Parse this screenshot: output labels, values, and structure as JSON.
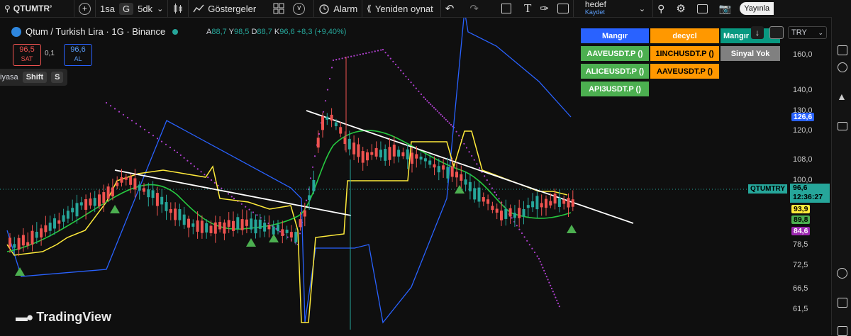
{
  "topbar": {
    "symbol": "QTUMTRʼ",
    "add": "+",
    "interval_1": "1sa",
    "interval_2": "G",
    "interval_3": "5dk",
    "chevron": "⌄",
    "indicators": "Göstergeler",
    "alert": "Alarm",
    "replay": "Yeniden oynat",
    "layout_name": "hedef",
    "layout_status": "Kaydet",
    "publish": "Yayınla",
    "v_label": "v",
    "text_tool": "T"
  },
  "header": {
    "title": "Qtum / Turkish Lira · 1G · Binance",
    "ohlc": [
      {
        "k": "A",
        "v": "88,7"
      },
      {
        "k": "Y",
        "v": "98,5"
      },
      {
        "k": "D",
        "v": "88,7"
      },
      {
        "k": "K",
        "v": "96,6"
      }
    ],
    "change": "+8,3 (+9,40%)",
    "sell_price": "96,5",
    "sell_label": "SAT",
    "spread": "0,1",
    "buy_price": "96,6",
    "buy_label": "AL"
  },
  "order_bar": {
    "text": "iyasa",
    "key1": "Shift",
    "key2": "S"
  },
  "scale_controls": {
    "currency": "TRY"
  },
  "table": {
    "headers": [
      {
        "text": "Mangır",
        "bg": "#2962ff",
        "fg": "#ffffff"
      },
      {
        "text": "decycl",
        "bg": "#ff9800",
        "fg": "#ffffff"
      },
      {
        "text": "Mangır 3b",
        "bg": "#089981",
        "fg": "#ffffff"
      }
    ],
    "rows": [
      [
        {
          "text": "AAVEUSDT.P ()",
          "bg": "#4caf50",
          "fg": "#ffffff"
        },
        {
          "text": "1INCHUSDT.P ()",
          "bg": "#ff9800",
          "fg": "#000000"
        },
        {
          "text": "Sinyal Yok",
          "bg": "#808080",
          "fg": "#ffffff"
        }
      ],
      [
        {
          "text": "ALICEUSDT.P ()",
          "bg": "#4caf50",
          "fg": "#ffffff"
        },
        {
          "text": "AAVEUSDT.P ()",
          "bg": "#ff9800",
          "fg": "#000000"
        }
      ],
      [
        {
          "text": "API3USDT.P ()",
          "bg": "#4caf50",
          "fg": "#ffffff"
        }
      ]
    ]
  },
  "y_axis": {
    "ticks": [
      "160,0",
      "140,0",
      "130,0",
      "120,0",
      "108,0",
      "100,0",
      "78,5",
      "72,5",
      "66,5",
      "61,5"
    ],
    "tags": [
      {
        "text": "126,6",
        "bg": "#2962ff",
        "fg": "#ffffff"
      },
      {
        "text": "93,9",
        "bg": "#ffeb3b",
        "fg": "#000000"
      },
      {
        "text": "89,8",
        "bg": "#4caf50",
        "fg": "#000000"
      },
      {
        "text": "84,6",
        "bg": "#9c27b0",
        "fg": "#ffffff"
      }
    ],
    "last_symbol": "QTUMTRY",
    "last_price": "96,6",
    "countdown": "12:36:27"
  },
  "branding": {
    "name": "TradingView"
  },
  "colors": {
    "up": "#26a69a",
    "down": "#ef5350",
    "accent": "#2962ff"
  }
}
